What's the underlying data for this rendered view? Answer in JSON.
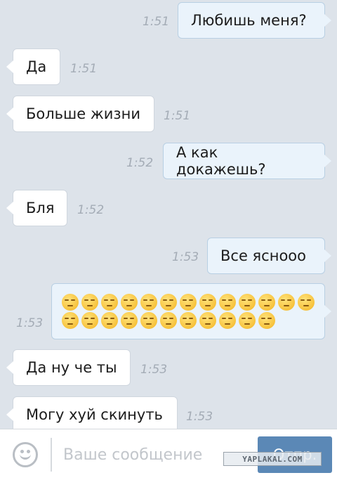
{
  "messages": [
    {
      "side": "out",
      "text": "Любишь меня?",
      "time": "1:51"
    },
    {
      "side": "in",
      "text": "Да",
      "time": "1:51"
    },
    {
      "side": "in",
      "text": "Больше жизни",
      "time": "1:51"
    },
    {
      "side": "out",
      "text": "А как докажешь?",
      "time": "1:52"
    },
    {
      "side": "in",
      "text": "Бля",
      "time": "1:52"
    },
    {
      "side": "out",
      "text": "Все ясноoo",
      "time": "1:53"
    },
    {
      "side": "out",
      "emoji": "unamused-face",
      "emoji_rows": [
        13,
        11
      ],
      "time": "1:53"
    },
    {
      "side": "in",
      "text": "Да ну че ты",
      "time": "1:53"
    },
    {
      "side": "in",
      "text": "Могу хуй скинуть",
      "time": "1:53"
    }
  ],
  "composer": {
    "placeholder": "Ваше сообщение",
    "send_label": "Отпр.",
    "emoji_icon": "smiley-icon"
  },
  "watermark": "YAPLAKAL.COM",
  "colors": {
    "background": "#dde3ea",
    "incoming_bubble": "#ffffff",
    "outgoing_bubble": "#eaf3fb",
    "send_button": "#5b88b6"
  }
}
